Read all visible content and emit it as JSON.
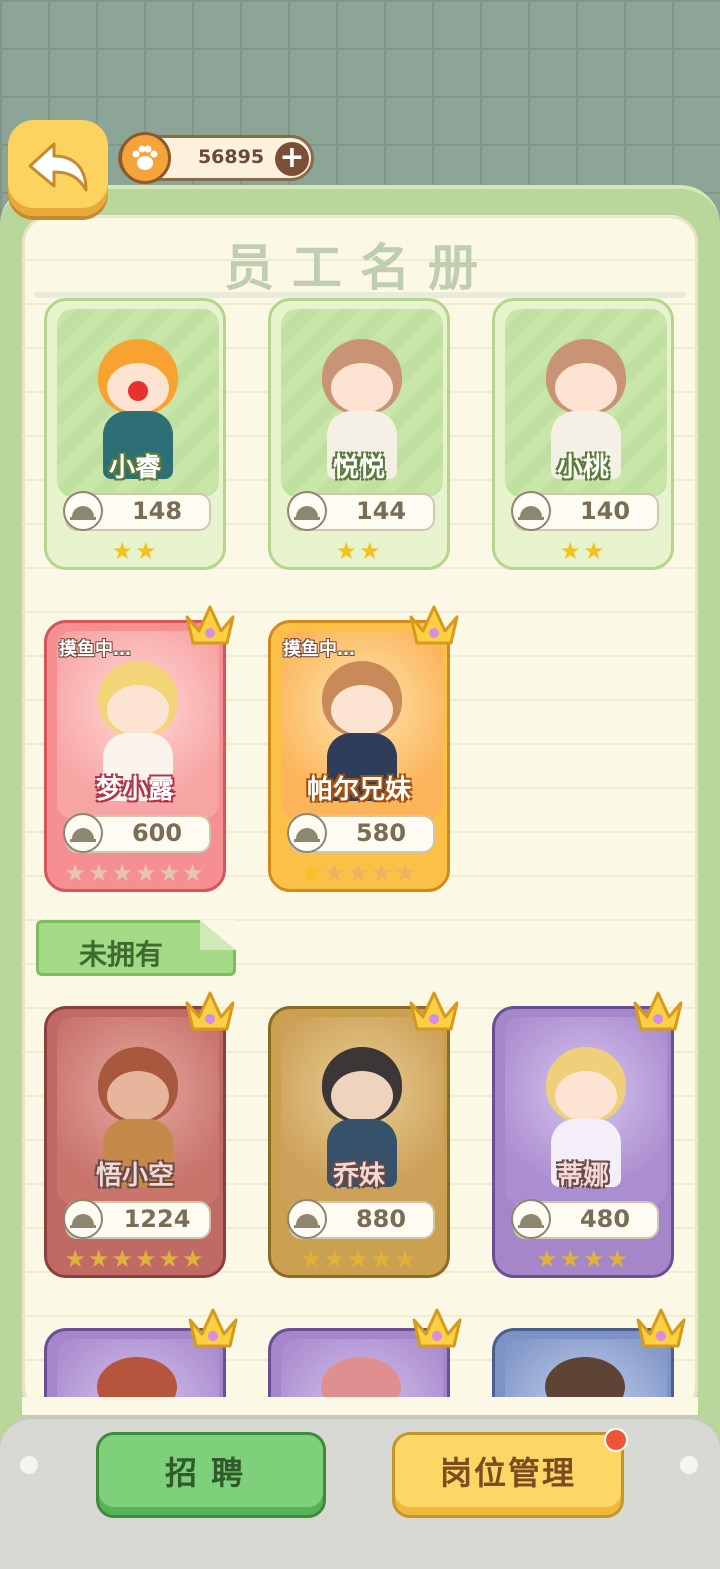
{
  "header": {
    "title": "员工名册",
    "currency": "56895"
  },
  "owned": [
    {
      "name": "小睿",
      "price": "148",
      "stars_on": 2,
      "stars_total": 2,
      "rarity": "green",
      "status": ""
    },
    {
      "name": "悦悦",
      "price": "144",
      "stars_on": 2,
      "stars_total": 2,
      "rarity": "green",
      "status": ""
    },
    {
      "name": "小桃",
      "price": "140",
      "stars_on": 2,
      "stars_total": 2,
      "rarity": "green",
      "status": ""
    },
    {
      "name": "梦小露",
      "price": "600",
      "stars_on": 0,
      "stars_total": 6,
      "rarity": "pink",
      "status": "摸鱼中…"
    },
    {
      "name": "帕尔兄妹",
      "price": "580",
      "stars_on": 1,
      "stars_total": 5,
      "rarity": "gold",
      "status": "摸鱼中…"
    }
  ],
  "section": {
    "not_owned_label": "未拥有"
  },
  "not_owned": [
    {
      "name": "悟小空",
      "price": "1224",
      "stars_on": 6,
      "stars_total": 6,
      "rarity": "locked-red"
    },
    {
      "name": "乔妹",
      "price": "880",
      "stars_on": 5,
      "stars_total": 5,
      "rarity": "locked-gold"
    },
    {
      "name": "蒂娜",
      "price": "480",
      "stars_on": 4,
      "stars_total": 4,
      "rarity": "locked-purple"
    }
  ],
  "footer": {
    "recruit_label": "招聘",
    "post_manage_label": "岗位管理"
  },
  "colors": {
    "accent_green": "#7fd07a",
    "accent_yellow": "#fdd766",
    "star": "#f5c224"
  }
}
